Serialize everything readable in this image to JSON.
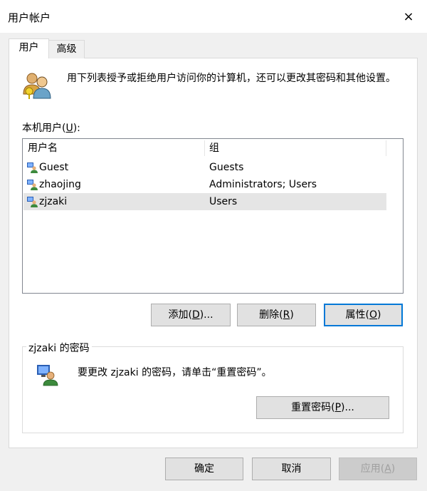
{
  "window": {
    "title": "用户帐户",
    "close_label": "×"
  },
  "tabs": [
    {
      "label": "用户"
    },
    {
      "label": "高级"
    }
  ],
  "intro_text": "用下列表授予或拒绝用户访问你的计算机，还可以更改其密码和其他设置。",
  "users_label_prefix": "本机用户(",
  "users_label_key": "U",
  "users_label_suffix": "):",
  "list": {
    "columns": [
      "用户名",
      "组"
    ],
    "rows": [
      {
        "name": "Guest",
        "group": "Guests"
      },
      {
        "name": "zhaojing",
        "group": "Administrators; Users"
      },
      {
        "name": "zjzaki",
        "group": "Users"
      }
    ]
  },
  "buttons": {
    "add": {
      "prefix": "添加(",
      "key": "D",
      "suffix": ")..."
    },
    "delete": {
      "prefix": "删除(",
      "key": "R",
      "suffix": ")"
    },
    "properties": {
      "prefix": "属性(",
      "key": "O",
      "suffix": ")"
    },
    "reset": {
      "prefix": "重置密码(",
      "key": "P",
      "suffix": ")..."
    },
    "ok": "确定",
    "cancel": "取消",
    "apply": {
      "prefix": "应用(",
      "key": "A",
      "suffix": ")"
    }
  },
  "password_group": {
    "title": "zjzaki 的密码",
    "text": "要更改 zjzaki 的密码，请单击“重置密码”。"
  },
  "colors": {
    "accent": "#0078d7",
    "selection": "#e5e5e5",
    "dialog_bg": "#f0f0f0"
  },
  "icons": {
    "users": "users-icon",
    "user": "user-icon",
    "close": "close-icon"
  }
}
